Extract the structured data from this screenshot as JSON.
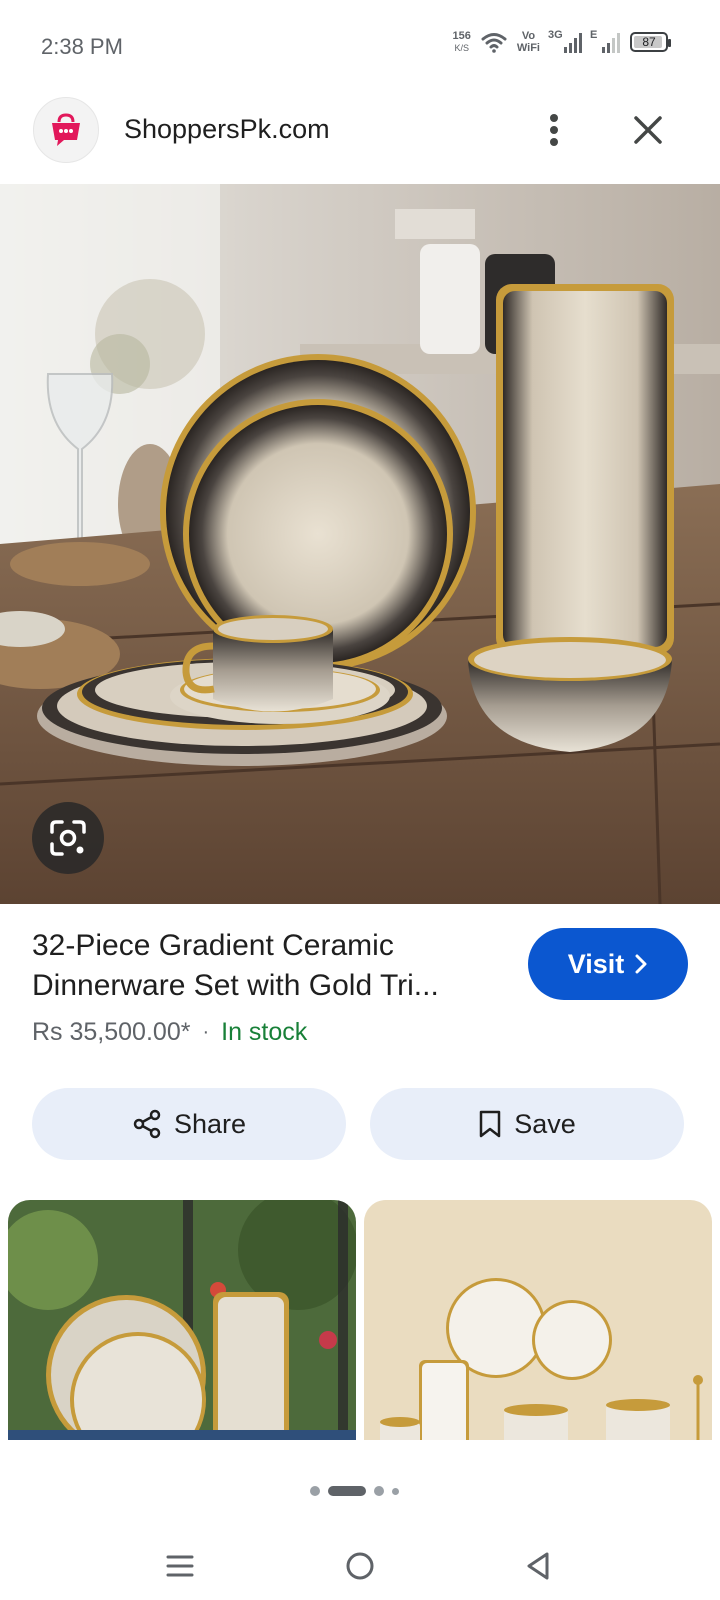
{
  "status_bar": {
    "time": "2:38 PM",
    "net_speed_value": "156",
    "net_speed_unit": "K/S",
    "vowifi_top": "Vo",
    "vowifi_bottom": "WiFi",
    "signal_1_label": "3G",
    "signal_2_label": "E",
    "battery_level": "87"
  },
  "header": {
    "site_name": "ShoppersPk.com",
    "logo_icon": "shopping-bag-chat-icon",
    "more_icon": "more-vert-icon",
    "close_icon": "close-icon"
  },
  "product": {
    "title": "32-Piece Gradient Ceramic Dinnerware Set with Gold Tri...",
    "price": "Rs 35,500.00*",
    "separator": "·",
    "availability": "In stock",
    "visit_label": "Visit"
  },
  "actions": {
    "share_label": "Share",
    "save_label": "Save"
  },
  "pager": {
    "page_count": 4,
    "active_index": 1
  },
  "colors": {
    "accent": "#0b57d0",
    "stock": "#188038",
    "chip_bg": "#e8eef9",
    "brand": "#e2185b"
  }
}
